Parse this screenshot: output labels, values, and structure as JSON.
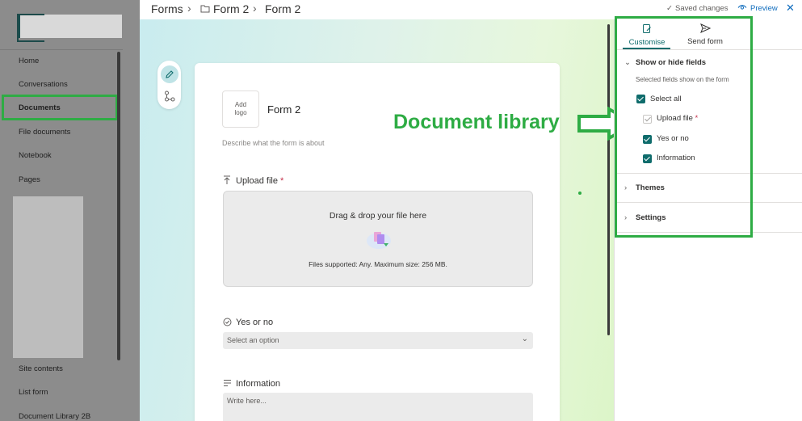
{
  "sidebar": {
    "items": [
      {
        "label": "Home"
      },
      {
        "label": "Conversations"
      },
      {
        "label": "Documents",
        "active": true
      },
      {
        "label": "File documents"
      },
      {
        "label": "Notebook"
      },
      {
        "label": "Pages"
      },
      {
        "label": "Site contents"
      },
      {
        "label": "List form"
      },
      {
        "label": "Document Library 2B"
      }
    ]
  },
  "topbar": {
    "breadcrumb": [
      "Forms",
      "Form 2",
      "Form 2"
    ],
    "saved_status": "Saved changes",
    "preview_label": "Preview",
    "close_icon": "close-icon"
  },
  "form": {
    "add_logo_label": "Add logo",
    "title": "Form 2",
    "description_placeholder": "Describe what the form is about",
    "upload_field": {
      "label": "Upload file",
      "required_mark": "*",
      "drop_title": "Drag & drop your file here",
      "supported_text": "Files supported: Any. Maximum size: 256 MB."
    },
    "yes_no_field": {
      "label": "Yes or no",
      "select_placeholder": "Select an option"
    },
    "information_field": {
      "label": "Information",
      "textarea_placeholder": "Write here..."
    }
  },
  "annotation": {
    "text": "Document library",
    "color": "#2eac44"
  },
  "panel": {
    "tabs": [
      {
        "label": "Customise",
        "icon": "edit-form-icon",
        "active": true
      },
      {
        "label": "Send form",
        "icon": "send-icon",
        "active": false
      }
    ],
    "show_hide": {
      "title": "Show or hide fields",
      "subtitle": "Selected fields show on the form",
      "select_all_label": "Select all",
      "fields": [
        {
          "label": "Upload file",
          "required_mark": "*",
          "checked": true,
          "disabled": true
        },
        {
          "label": "Yes or no",
          "checked": true,
          "disabled": false
        },
        {
          "label": "Information",
          "checked": true,
          "disabled": false
        }
      ]
    },
    "themes_label": "Themes",
    "settings_label": "Settings"
  },
  "colors": {
    "accent": "#0f6c6c",
    "highlight_green": "#2eac44",
    "link_blue": "#0f6cbd"
  }
}
